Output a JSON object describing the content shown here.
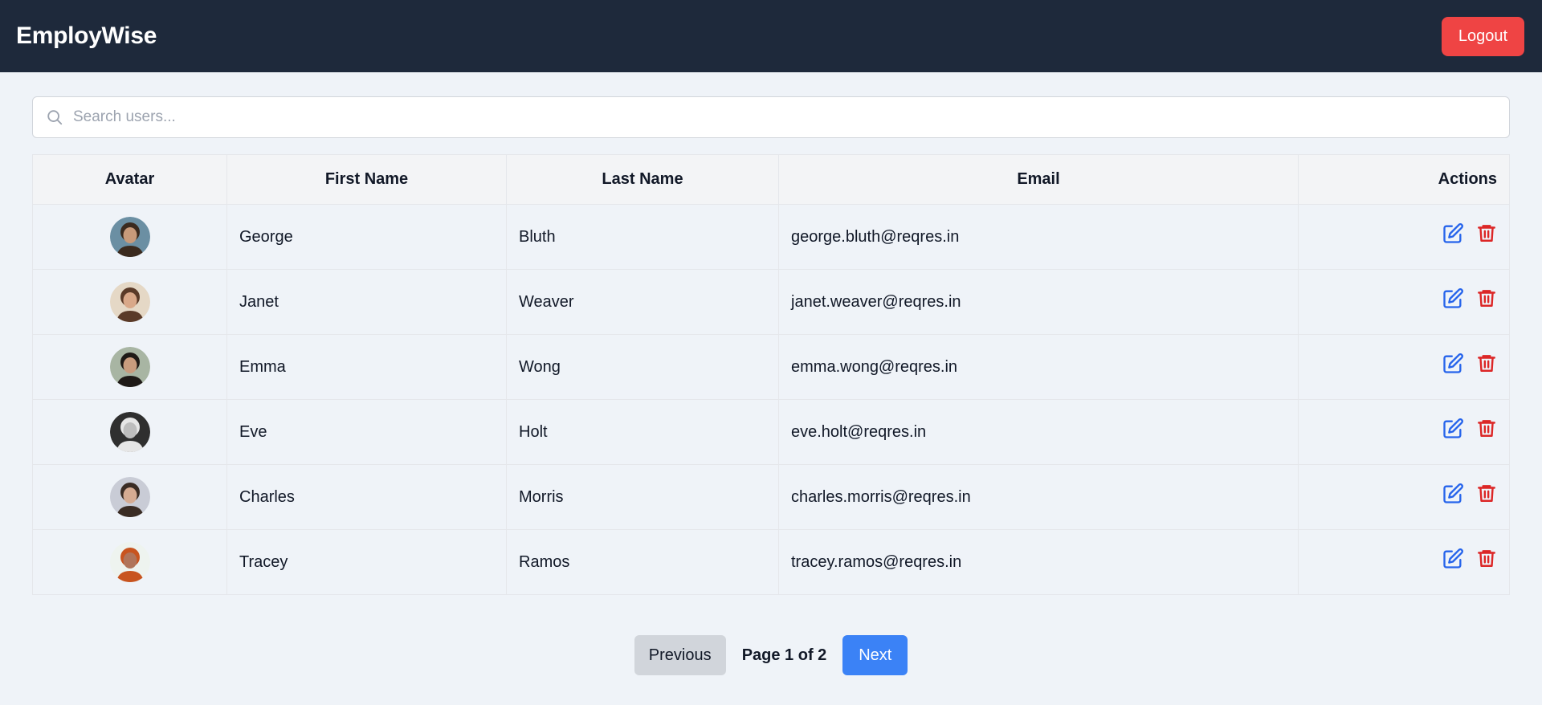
{
  "navbar": {
    "brand": "EmployWise",
    "logout_label": "Logout"
  },
  "search": {
    "placeholder": "Search users...",
    "value": ""
  },
  "table": {
    "headers": {
      "avatar": "Avatar",
      "first_name": "First Name",
      "last_name": "Last Name",
      "email": "Email",
      "actions": "Actions"
    },
    "rows": [
      {
        "first_name": "George",
        "last_name": "Bluth",
        "email": "george.bluth@reqres.in",
        "avatar_bg": "#6b8fa3",
        "avatar_skin": "#c89a7a",
        "avatar_hair": "#3b2a1e"
      },
      {
        "first_name": "Janet",
        "last_name": "Weaver",
        "email": "janet.weaver@reqres.in",
        "avatar_bg": "#e5d8c6",
        "avatar_skin": "#d9a889",
        "avatar_hair": "#5a3a28"
      },
      {
        "first_name": "Emma",
        "last_name": "Wong",
        "email": "emma.wong@reqres.in",
        "avatar_bg": "#a8b5a3",
        "avatar_skin": "#c99c7e",
        "avatar_hair": "#1f1a17"
      },
      {
        "first_name": "Eve",
        "last_name": "Holt",
        "email": "eve.holt@reqres.in",
        "avatar_bg": "#2f2f2f",
        "avatar_skin": "#bdbdbd",
        "avatar_hair": "#e6e6e6"
      },
      {
        "first_name": "Charles",
        "last_name": "Morris",
        "email": "charles.morris@reqres.in",
        "avatar_bg": "#c9ccd6",
        "avatar_skin": "#d5ab92",
        "avatar_hair": "#3a2c24"
      },
      {
        "first_name": "Tracey",
        "last_name": "Ramos",
        "email": "tracey.ramos@reqres.in",
        "avatar_bg": "#eef3ef",
        "avatar_skin": "#b0745a",
        "avatar_hair": "#c8541f"
      }
    ]
  },
  "icons": {
    "edit": "edit-icon",
    "delete": "trash-icon",
    "search": "search-icon"
  },
  "colors": {
    "edit": "#2563eb",
    "delete": "#dc2626",
    "navbar": "#1e293b",
    "logout": "#ef4444",
    "next": "#3b82f6"
  },
  "pagination": {
    "prev_label": "Previous",
    "page_info": "Page 1 of 2",
    "next_label": "Next"
  }
}
